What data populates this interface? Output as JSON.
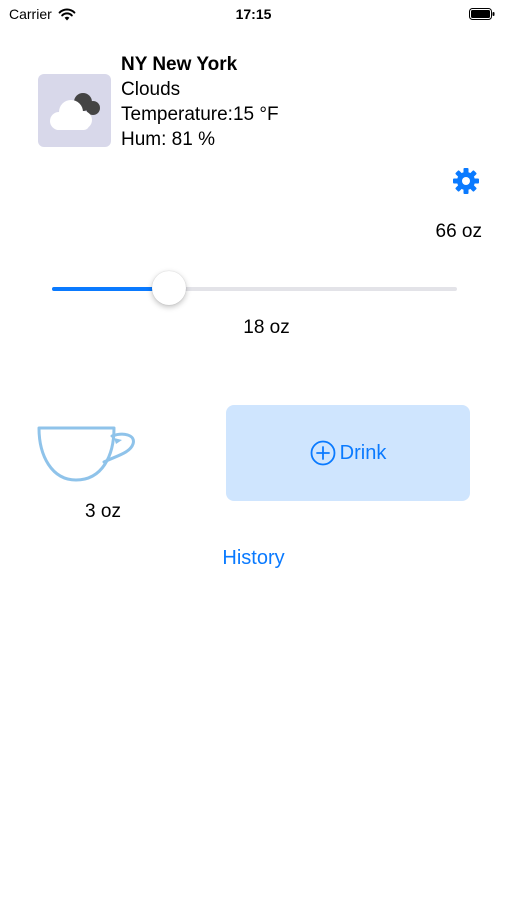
{
  "status_bar": {
    "carrier": "Carrier",
    "time": "17:15"
  },
  "weather": {
    "city": "NY New York",
    "condition": "Clouds",
    "temperature": "Temperature:15 °F",
    "humidity": "Hum:  81 %",
    "icon": "clouds-icon"
  },
  "goal": {
    "value": "66 oz"
  },
  "slider": {
    "value_label": "18 oz",
    "fraction": 0.29
  },
  "cup": {
    "size_label": "3 oz",
    "icon": "cup-icon"
  },
  "drink_button": {
    "label": "Drink",
    "icon": "plus-circle-icon"
  },
  "history_link": {
    "label": "History"
  },
  "colors": {
    "accent": "#0a7aff",
    "button_bg": "#cfe5fe",
    "cup_stroke": "#8fc3ea",
    "weather_bg": "#d8d8ea"
  }
}
